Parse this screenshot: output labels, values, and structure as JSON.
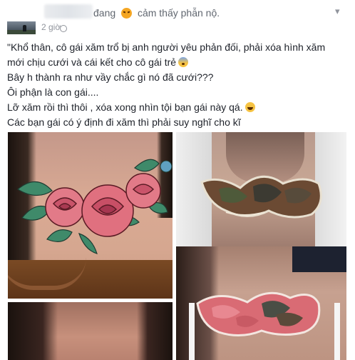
{
  "post": {
    "status_action": "đang",
    "status_feeling": "cảm thấy phẫn nộ.",
    "time": "2 giờ",
    "lines": [
      "\"Khổ thân, cô gái xăm trổ bị anh người yêu phản đối, phải xóa hình xăm",
      "mới chịu cưới và cái kết cho cô gái trẻ",
      "Bây h thành ra như vầy chắc gì nó đã cưới???",
      "Ôi phận là con gái....",
      "Lỡ xăm rồi thì thôi , xóa xong nhìn tội bạn gái này qá.",
      "Các bạn gái có ý định đi xăm thì phải suy nghĩ cho kĩ"
    ]
  },
  "icons": {
    "status_emoji": "angry-face-icon",
    "line2_emoji": "fearful-face-icon",
    "line5_emoji": "laughing-face-icon",
    "menu": "chevron-down-icon",
    "privacy": "globe-icon"
  },
  "colors": {
    "text": "#1d2129",
    "meta": "#90949c",
    "status": "#616770"
  },
  "photos": [
    {
      "content": "rose-tattoo-chest"
    },
    {
      "content": "burned-tattoo-removal-chest"
    },
    {
      "content": "tattoo-removal-scarring-chest"
    },
    {
      "content": "bare-chest-after-removal"
    }
  ]
}
